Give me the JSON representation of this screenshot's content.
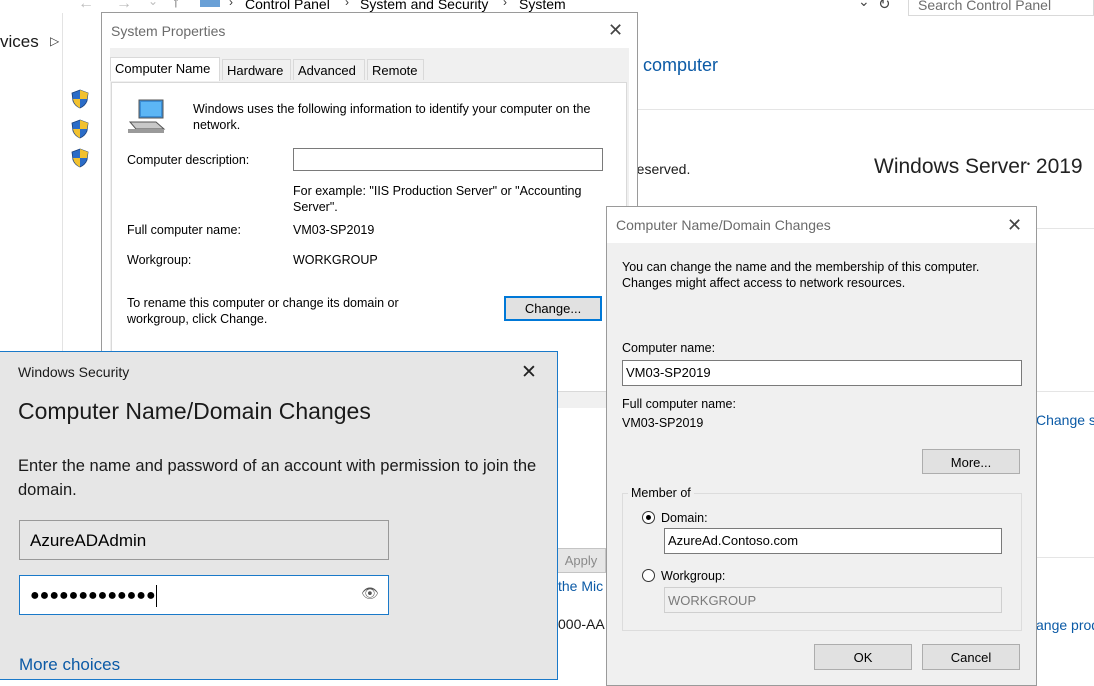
{
  "background": {
    "breadcrumbs": [
      "Control Panel",
      "System and Security",
      "System"
    ],
    "search_placeholder": "Search Control Panel",
    "left_text": "vices",
    "title_link": "r computer",
    "reserved_text": "reserved.",
    "os_name": "Windows Server",
    "os_version": "2019",
    "change_link": "Change s",
    "change_prod": "ange prod",
    "apply_label": "Apply",
    "mic_text": "the Mic",
    "product_fragment": "000-AA"
  },
  "system_properties": {
    "title": "System Properties",
    "tabs": [
      {
        "label": "Computer Name"
      },
      {
        "label": "Hardware"
      },
      {
        "label": "Advanced"
      },
      {
        "label": "Remote"
      }
    ],
    "info": "Windows uses the following information to identify your computer on the network.",
    "description_label": "Computer description:",
    "description_value": "",
    "example": "For example: \"IIS Production Server\" or \"Accounting Server\".",
    "full_name_label": "Full computer name:",
    "full_name_value": "VM03-SP2019",
    "workgroup_label": "Workgroup:",
    "workgroup_value": "WORKGROUP",
    "rename_text": "To rename this computer or change its domain or workgroup, click Change.",
    "change_button": "Change..."
  },
  "domain_changes": {
    "title": "Computer Name/Domain Changes",
    "info": "You can change the name and the membership of this computer. Changes might affect access to network resources.",
    "computer_name_label": "Computer name:",
    "computer_name_value": "VM03-SP2019",
    "full_name_label": "Full computer name:",
    "full_name_value": "VM03-SP2019",
    "more_button": "More...",
    "member_of_label": "Member of",
    "domain_label": "Domain:",
    "domain_value": "AzureAd.Contoso.com",
    "workgroup_label": "Workgroup:",
    "workgroup_value": "WORKGROUP",
    "ok_button": "OK",
    "cancel_button": "Cancel"
  },
  "windows_security": {
    "caption": "Windows Security",
    "heading": "Computer Name/Domain Changes",
    "instruction": "Enter the name and password of an account with permission to join the domain.",
    "username_value": "AzureADAdmin",
    "password_mask": "●●●●●●●●●●●●●",
    "more_choices": "More choices"
  }
}
